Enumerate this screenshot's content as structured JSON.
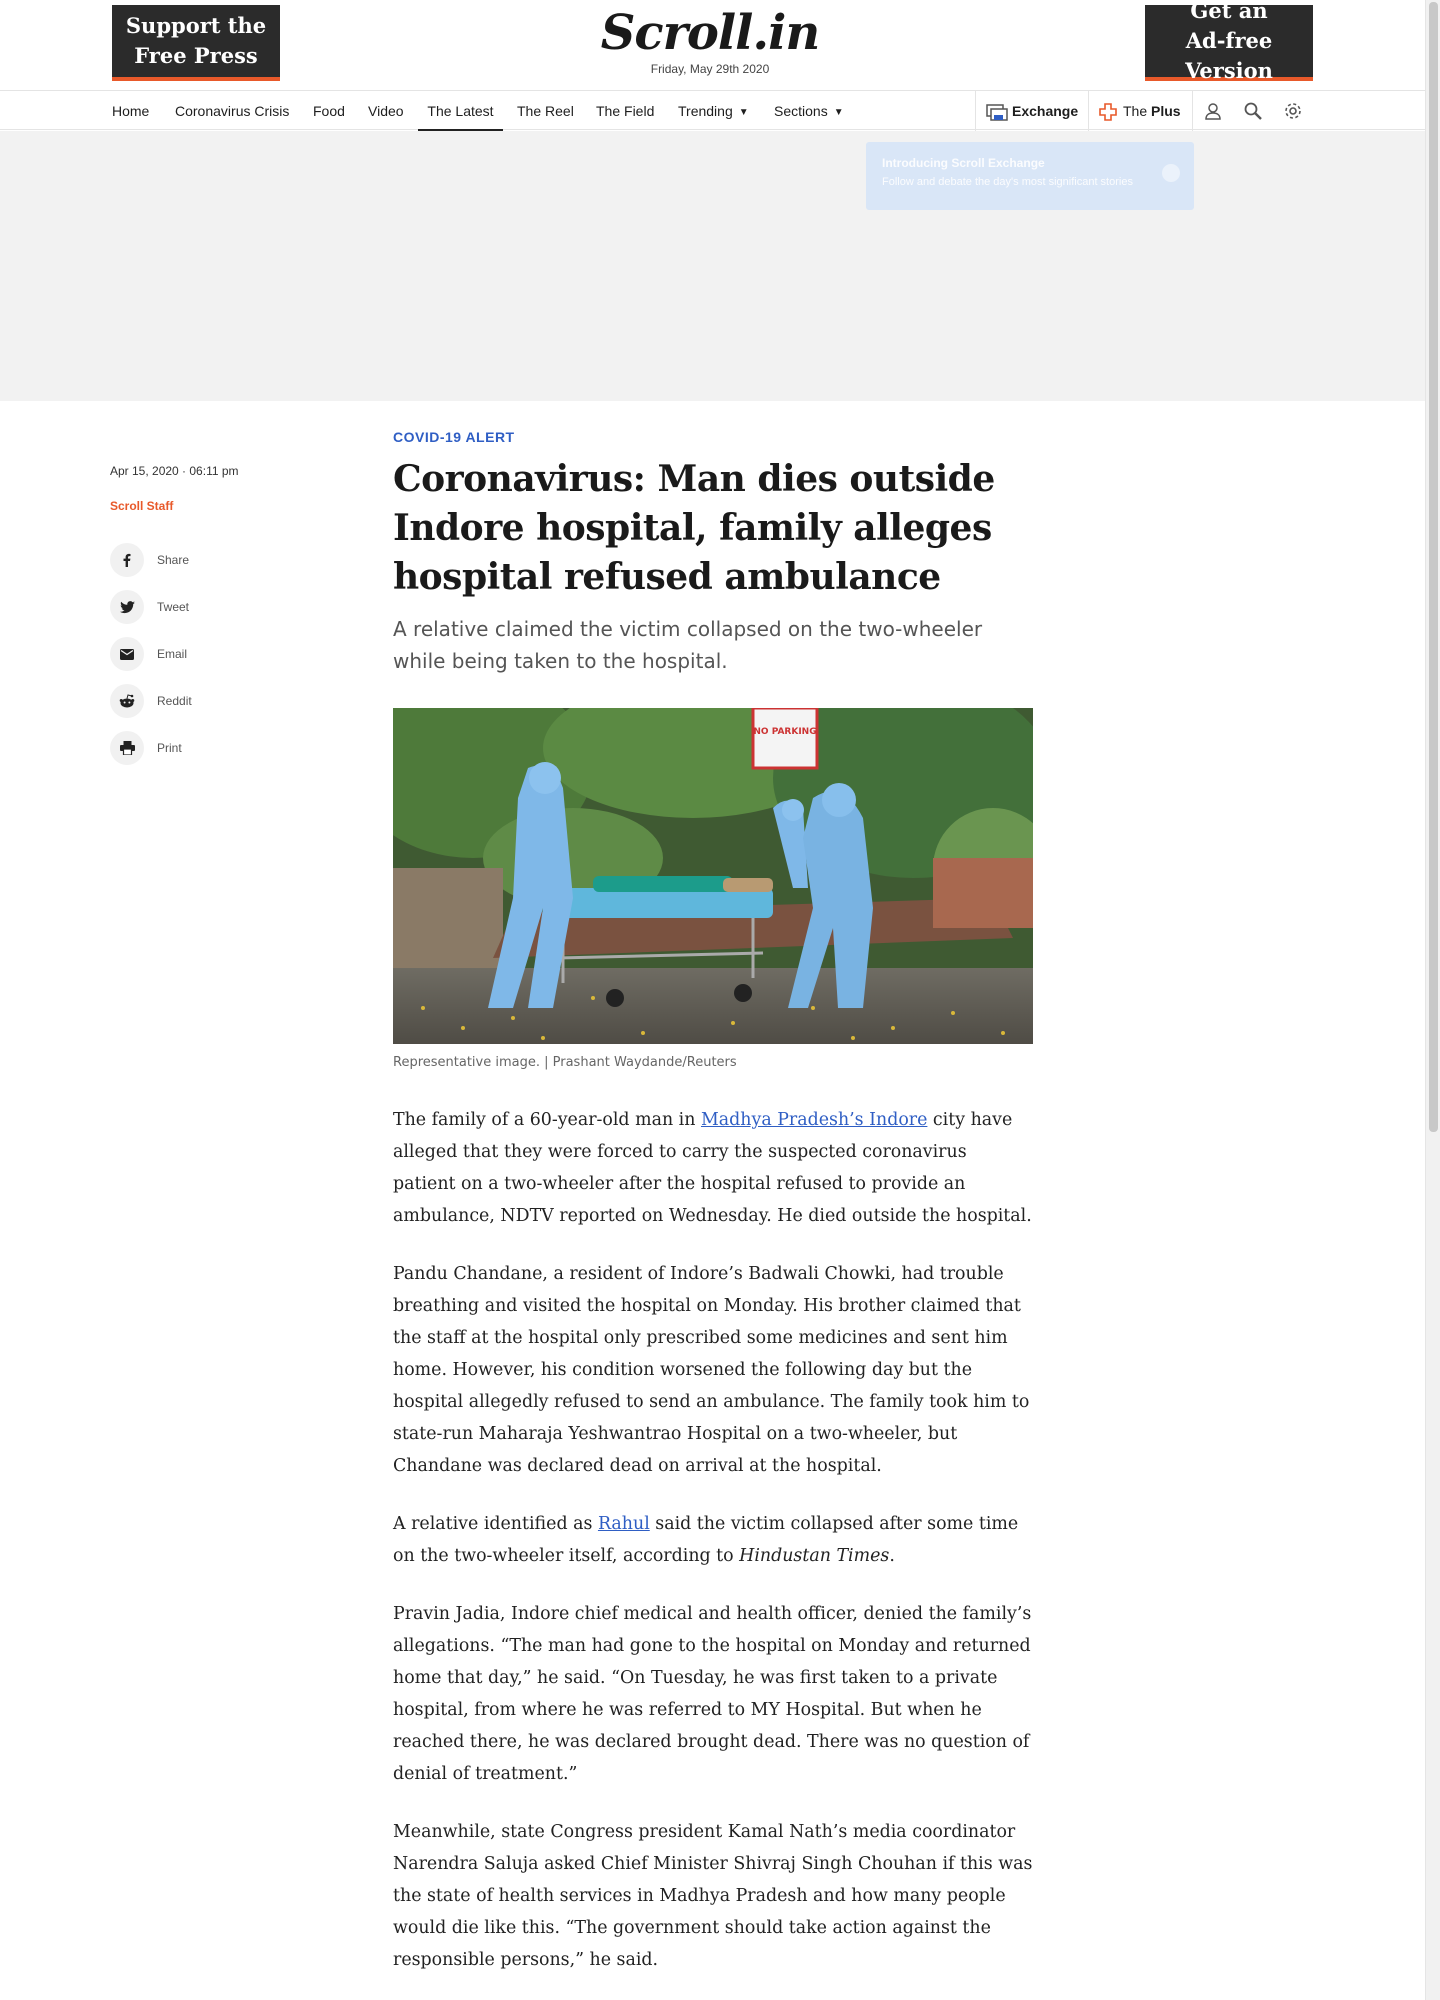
{
  "masthead": {
    "support_label": "Support the\nFree Press",
    "adfree_label": "Get an\nAd-free Version",
    "logo_text": "Scroll.in",
    "date": "Friday, May 29th 2020"
  },
  "nav": {
    "items": [
      "Home",
      "Coronavirus Crisis",
      "Food",
      "Video",
      "The Latest",
      "The Reel",
      "The Field",
      "Trending",
      "Sections"
    ],
    "active": "The Latest",
    "exchange_label": "Exchange",
    "plus_prefix": "The",
    "plus_label": "Plus"
  },
  "tooltip": {
    "title": "Introducing Scroll Exchange",
    "subtitle": "Follow and debate the day's most significant stories"
  },
  "meta": {
    "date": "Apr 15, 2020 · 06:11 pm",
    "author": "Scroll Staff",
    "share": [
      "Share",
      "Tweet",
      "Email",
      "Reddit",
      "Print"
    ]
  },
  "article": {
    "kicker": "COVID-19 ALERT",
    "headline": "Coronavirus: Man dies outside Indore hospital, family alleges hospital refused ambulance",
    "standfirst": "A relative claimed the victim collapsed on the two-wheeler while being taken to the hospital.",
    "image_sign": "NO PARKING",
    "caption": "Representative image. | Prashant Waydande/Reuters",
    "p1_before": "The family of a 60-year-old man in ",
    "p1_link": "Madhya Pradesh’s Indore",
    "p1_after": " city have alleged that they were forced to carry the suspected coronavirus patient on a two-wheeler after the hospital refused to provide an ambulance, NDTV reported on Wednesday. He died outside the hospital.",
    "p2": "Pandu Chandane, a resident of Indore’s Badwali Chowki, had trouble breathing and visited the hospital on Monday. His brother claimed that the staff at the hospital only prescribed some medicines and sent him home. However, his condition worsened the following day but the hospital allegedly refused to send an ambulance. The family took him to state-run Maharaja Yeshwantrao Hospital on a two-wheeler, but Chandane was declared dead on arrival at the hospital.",
    "p3_before": "A relative identified as ",
    "p3_link": "Rahul",
    "p3_mid": " said the victim collapsed after some time on the two-wheeler itself, according to ",
    "p3_italic": "Hindustan Times",
    "p3_after": ".",
    "p4": "Pravin Jadia, Indore chief medical and health officer, denied the family’s allegations. “The man had gone to the hospital on Monday and returned home that day,” he said. “On Tuesday, he was first taken to a private hospital, from where he was referred to MY Hospital. But when he reached there, he was declared brought dead. There was no question of denial of treatment.”",
    "p5": "Meanwhile, state Congress president Kamal Nath’s media coordinator Narendra Saluja asked Chief Minister Shivraj Singh Chouhan if this was the state of health services in Madhya Pradesh and how many people would die like this. “The government should take action against the responsible persons,” he said."
  },
  "colors": {
    "accent_orange": "#e8592a",
    "link_blue": "#2f5ec4",
    "promo_dark": "#2b2b2b"
  }
}
